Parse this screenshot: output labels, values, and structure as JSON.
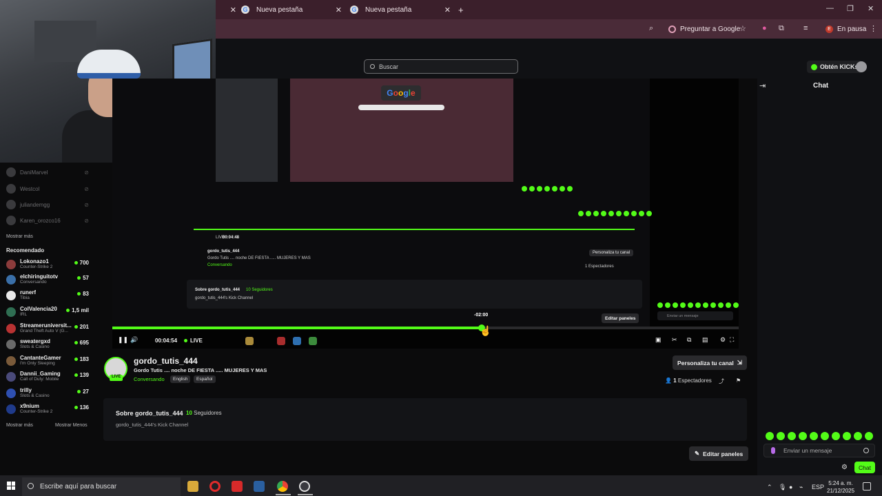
{
  "browser": {
    "tabs": [
      {
        "label": "Nueva pestaña"
      },
      {
        "label": "Nueva pestaña"
      }
    ],
    "ask_google_label": "Preguntar a Google",
    "paused_label": "En pausa",
    "profile_initial": "E"
  },
  "kick": {
    "search_placeholder": "Buscar",
    "kicks_label": "Obtén KICKs",
    "favorites": [
      "DaniMarvel",
      "Westcol",
      "juliandemgg",
      "Karen_orozco16"
    ],
    "show_more": "Mostrar más",
    "show_less": "Mostrar Menos",
    "recommended_heading": "Recomendado",
    "recommended": [
      {
        "name": "Lokonazo1",
        "category": "Counter-Strike 2",
        "viewers": "700"
      },
      {
        "name": "elchiringuitotv",
        "category": "Conversando",
        "viewers": "57"
      },
      {
        "name": "runerf",
        "category": "Tibia",
        "viewers": "83"
      },
      {
        "name": "ColValencia20",
        "category": "IRL",
        "viewers": "1,5 mil"
      },
      {
        "name": "Streameruniversit...",
        "category": "Grand Theft Auto V (G...",
        "viewers": "201"
      },
      {
        "name": "sweatergxd",
        "category": "Slots & Casino",
        "viewers": "695"
      },
      {
        "name": "CantanteGamer",
        "category": "I'm Only Sleeping",
        "viewers": "183"
      },
      {
        "name": "Dannii_Gaming",
        "category": "Call of Duty: Mobile",
        "viewers": "139"
      },
      {
        "name": "trilly",
        "category": "Slots & Casino",
        "viewers": "27"
      },
      {
        "name": "x9nium",
        "category": "Counter-Strike 2",
        "viewers": "136"
      }
    ],
    "player": {
      "seek_time": "-02:00",
      "elapsed": "00:04:54",
      "live_label": "LIVE",
      "progress_fraction": 0.59
    },
    "channel": {
      "name": "gordo_tutis_444",
      "live_badge": "LIVE",
      "title": "Gordo Tutis .... noche DE FIESTA ..... MUJERES Y MAS",
      "category": "Conversando",
      "languages": [
        "English",
        "Español"
      ],
      "customize_label": "Personaliza tu canal",
      "viewers_count": "1",
      "viewers_label": "Espectadores",
      "about_title": "Sobre gordo_tutis_444",
      "followers_count": "10",
      "followers_label": "Seguidores",
      "description": "gordo_tutis_444's Kick Channel",
      "edit_panels_label": "Editar paneles"
    },
    "nested": {
      "about_title": "Sobre gordo_tutis_444",
      "followers": "10 Seguidores",
      "description": "gordo_tutis_444's Kick Channel",
      "time": "00:04:48",
      "customize": "Personaliza tu canal",
      "viewers": "1 Espectadores"
    },
    "chat": {
      "title": "Chat",
      "input_placeholder": "Enviar un mensaje",
      "send_label": "Chat"
    }
  },
  "taskbar": {
    "search_placeholder": "Escribe aquí para buscar",
    "lang": "ESP",
    "time": "5:24 a. m.",
    "date": "21/12/2025"
  },
  "colors": {
    "accent": "#53fc18",
    "tab_bar": "#3b1f2b",
    "toolbar": "#4a2b38"
  }
}
